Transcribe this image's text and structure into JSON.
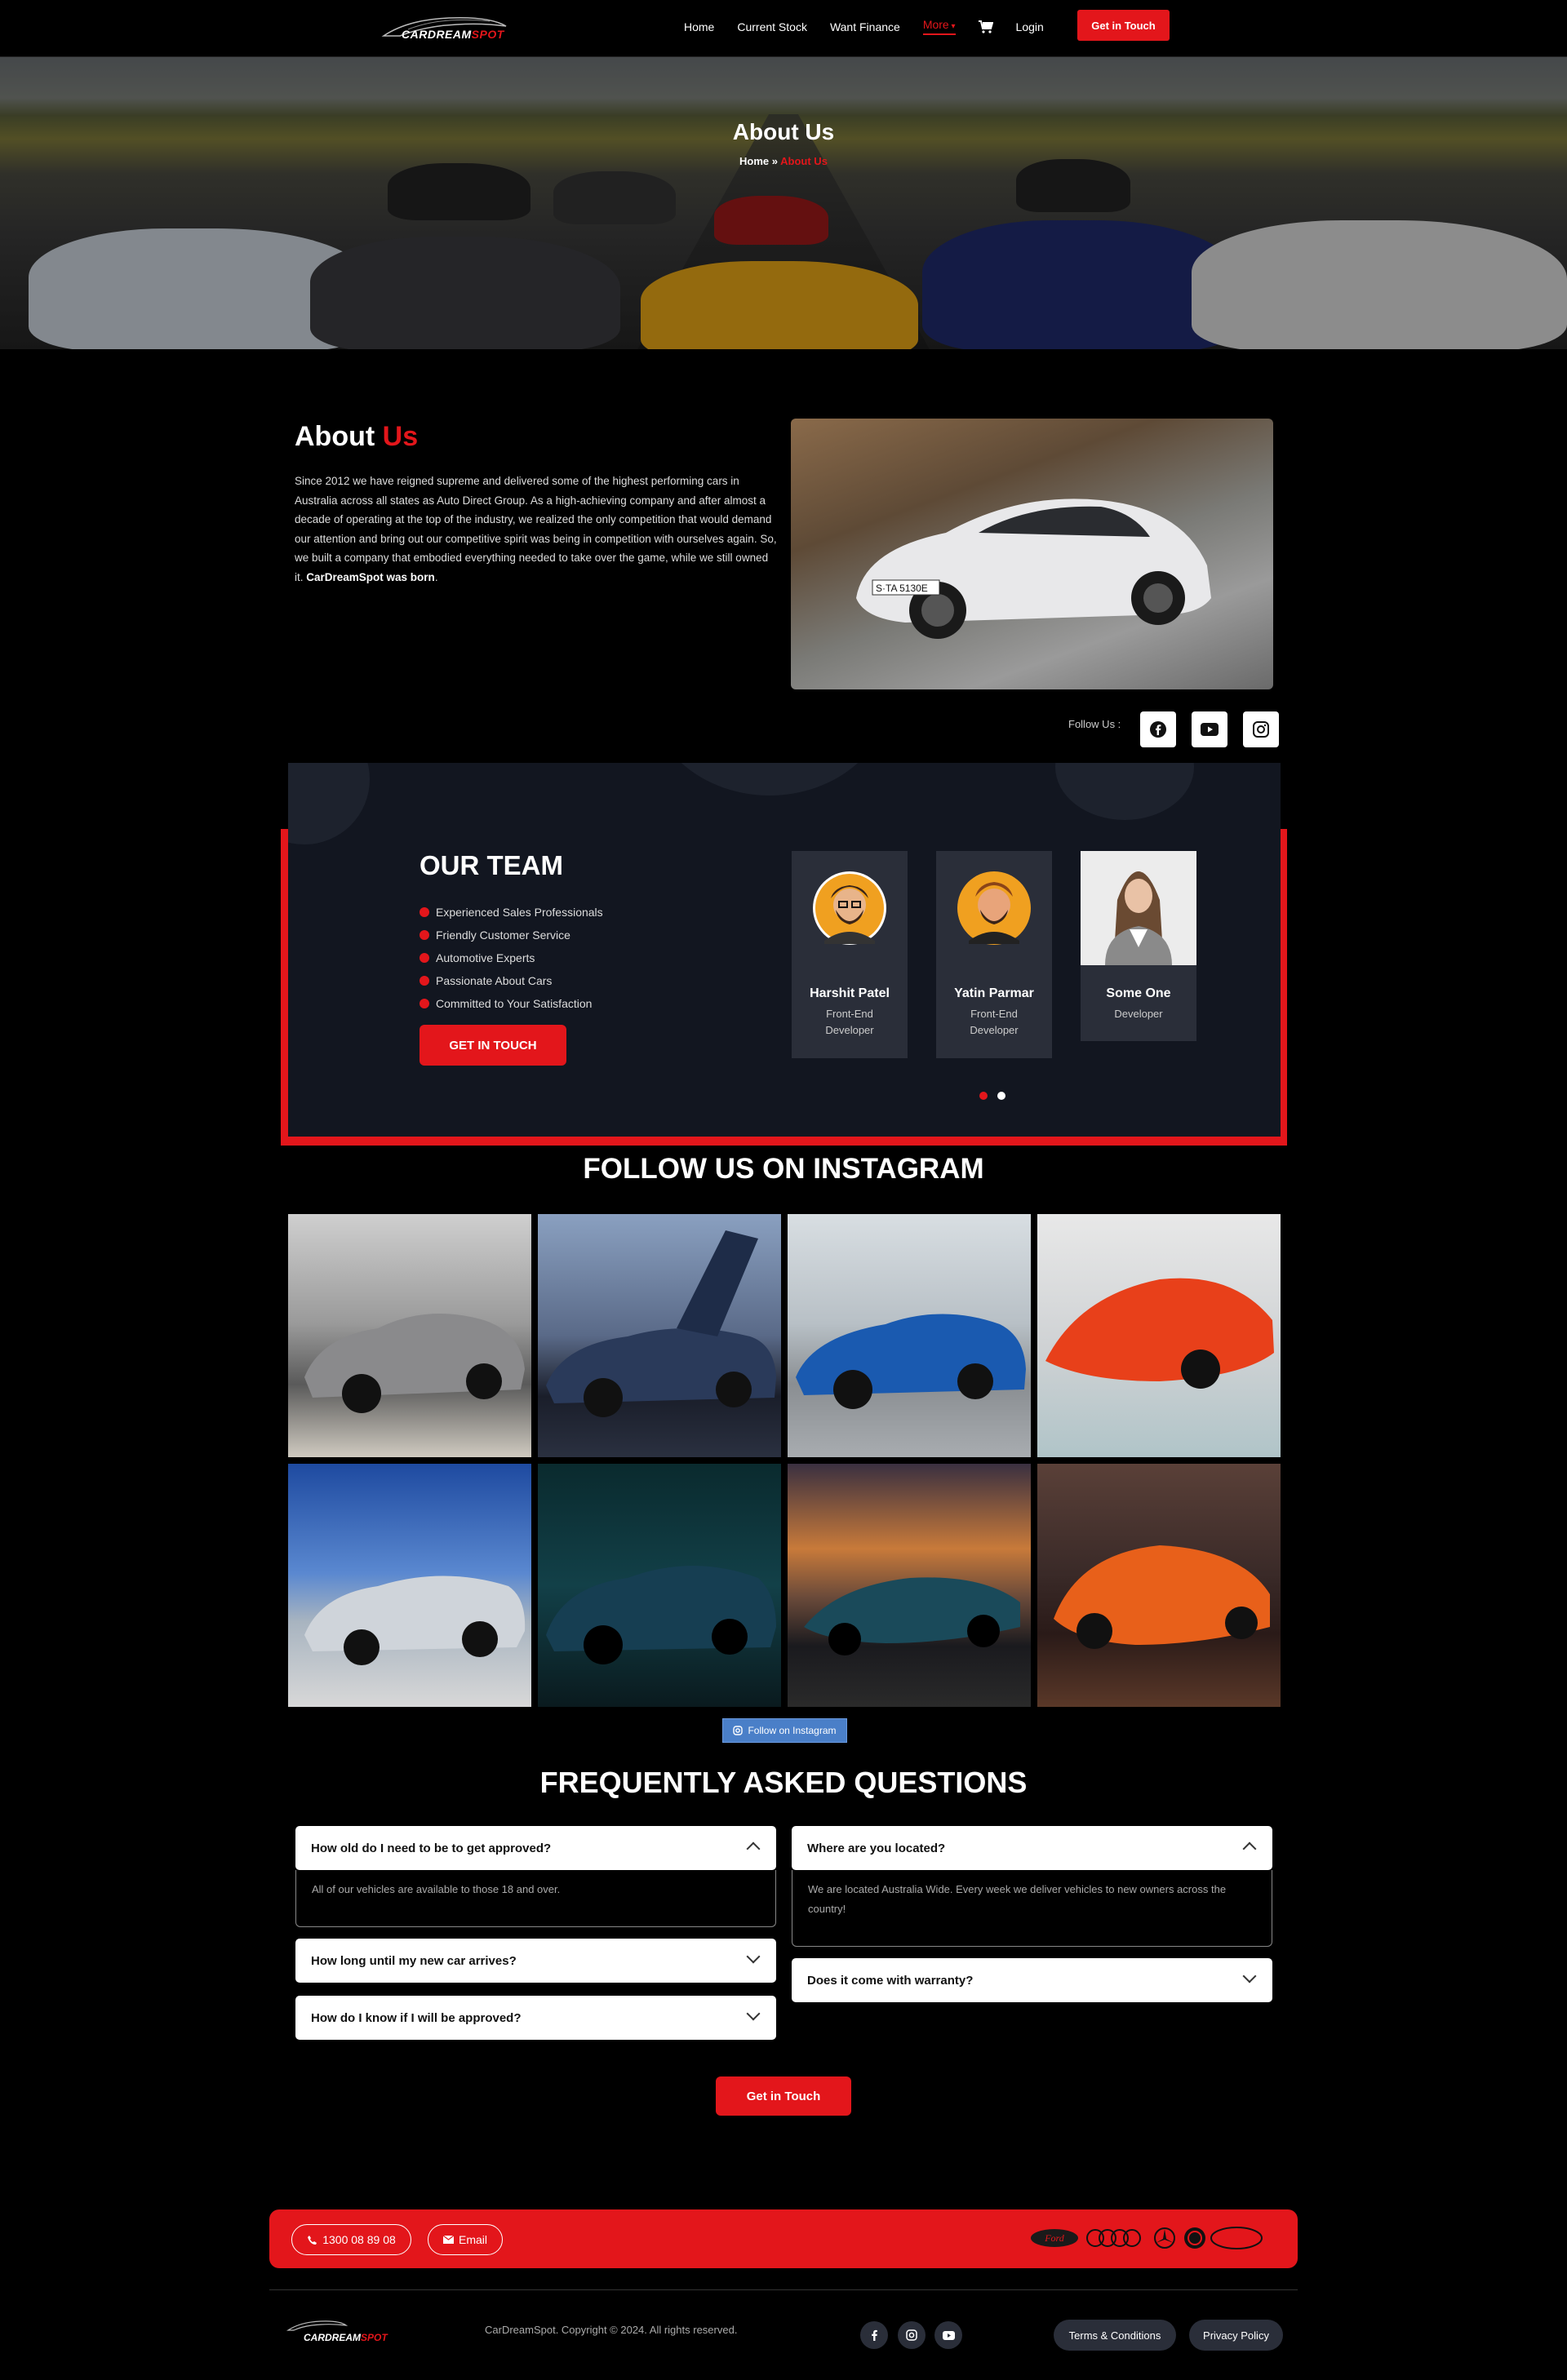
{
  "brand": {
    "name_a": "CARDREAM",
    "name_b": "SPOT",
    "accent": "#e3161b"
  },
  "nav": {
    "links": [
      "Home",
      "Current Stock",
      "Want Finance",
      "More",
      "Login"
    ],
    "cta": "Get in Touch"
  },
  "hero": {
    "title": "About Us",
    "crumb_home": "Home",
    "crumb_sep": " » ",
    "crumb_current": "About Us"
  },
  "about": {
    "title_a": "About ",
    "title_b": "Us",
    "text": "Since 2012 we have reigned supreme and delivered some of the highest performing cars in Australia across all states as Auto Direct Group. As a high-achieving company and after almost a decade of operating at the top of the industry, we realized the only competition that would demand our attention and bring out our competitive spirit was being in competition with ourselves again. So, we built a company that embodied everything needed to take over the game, while we still owned it. ",
    "text_bold": "CarDreamSpot was born",
    "text_end": ".",
    "plate": "S·TA 5130E",
    "follow_label": "Follow Us :",
    "social_icons": [
      "facebook-icon",
      "youtube-icon",
      "instagram-icon"
    ]
  },
  "team": {
    "title": "OUR TEAM",
    "points": [
      "Experienced Sales Professionals",
      "Friendly Customer Service",
      "Automotive Experts",
      "Passionate About Cars",
      "Committed to Your Satisfaction"
    ],
    "cta": "GET IN TOUCH",
    "members": [
      {
        "name": "Harshit Patel",
        "role": "Front-End Developer"
      },
      {
        "name": "Yatin Parmar",
        "role": "Front-End Developer"
      },
      {
        "name": "Some One",
        "role": "Developer"
      }
    ]
  },
  "instagram": {
    "title": "FOLLOW US ON INSTAGRAM",
    "button": "Follow on Instagram"
  },
  "faq": {
    "title": "FREQUENTLY ASKED QUESTIONS",
    "left": [
      {
        "q": "How old do I need to be to get approved?",
        "a": "All of our vehicles are available to those 18 and over.",
        "open": true
      },
      {
        "q": "How long until my new car arrives?",
        "open": false
      },
      {
        "q": "How do I know if I will be approved?",
        "open": false
      }
    ],
    "right": [
      {
        "q": "Where are you located?",
        "a": "We are located Australia Wide. Every week we deliver vehicles to new owners across the country!",
        "open": true
      },
      {
        "q": "Does it come with warranty?",
        "open": false
      }
    ],
    "cta": "Get in Touch"
  },
  "footer": {
    "phone": "1300 08 89 08",
    "email": "Email",
    "copyright": "CarDreamSpot. Copyright © 2024. All rights reserved.",
    "terms": "Terms & Conditions",
    "privacy": "Privacy Policy",
    "brand_logo_text": "Ford",
    "social_icons": [
      "facebook-icon",
      "instagram-icon",
      "youtube-icon"
    ]
  }
}
